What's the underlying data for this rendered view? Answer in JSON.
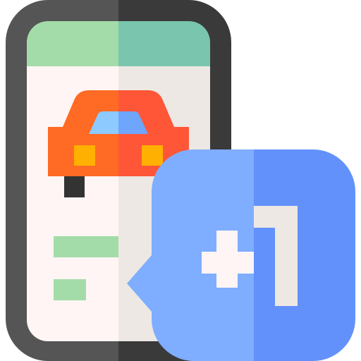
{
  "icon": {
    "name": "car-booking-plus-one-icon",
    "parts": {
      "phone": "smartphone-icon",
      "car": "car-icon",
      "bubble": "speech-bubble-icon",
      "plus": "plus-icon",
      "one": "number-one-glyph"
    }
  },
  "colors": {
    "phone_frame_left": "#555555",
    "phone_frame_right": "#3a3a3a",
    "screen_left": "#fff5f5",
    "screen_right": "#ede8e3",
    "header_left": "#a3dca8",
    "header_right": "#7ac5ae",
    "car_left": "#ff6a24",
    "car_right": "#ff5638",
    "car_window_left": "#8ccaff",
    "car_window_right": "#6fa5fb",
    "car_light": "#ffb000",
    "wheel": "#333333",
    "text_lines": "#a3dca8",
    "bubble_left": "#7fadff",
    "bubble_right": "#6391fb",
    "plus": "#fff5f5",
    "one": "#ede8e3"
  }
}
